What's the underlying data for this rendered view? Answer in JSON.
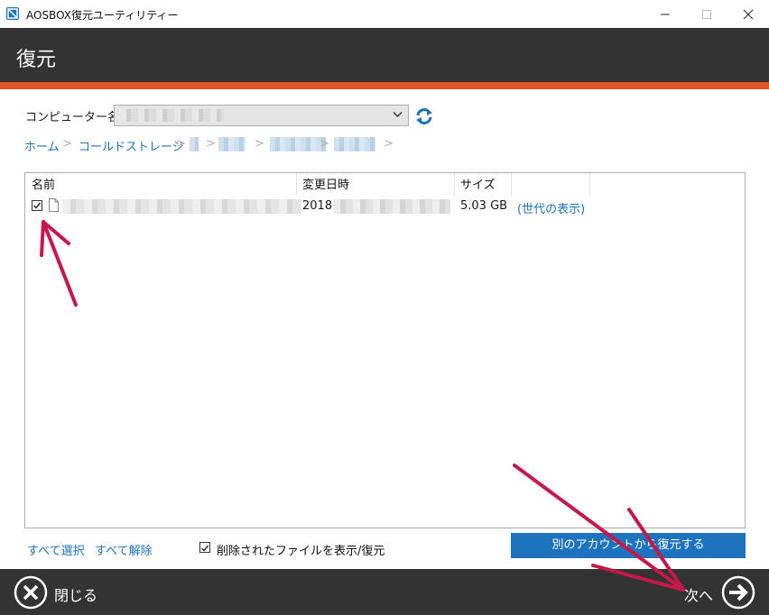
{
  "window": {
    "title": "AOSBOX復元ユーティリティー",
    "icon": "aosbox-app-icon",
    "controls": [
      "minimize-icon",
      "maximize-icon",
      "close-icon"
    ]
  },
  "header": {
    "title": "復元"
  },
  "computer": {
    "label": "コンピューター名:",
    "value": "",
    "refresh_icon": "refresh-icon"
  },
  "breadcrumb": {
    "items": [
      "ホーム",
      "コールドストレージ"
    ],
    "separator": ">"
  },
  "file_list": {
    "columns": [
      "名前",
      "変更日時",
      "サイズ"
    ],
    "rows": [
      {
        "checked": true,
        "name": "",
        "modified_prefix": "2018",
        "size": "5.03 GB",
        "generations_link": "(世代の表示)"
      }
    ]
  },
  "actions": {
    "select_all": "すべて選択",
    "deselect_all": "すべて解除",
    "show_deleted": {
      "checked": true,
      "label": "削除されたファイルを表示/復元"
    },
    "restore_other_account": "別のアカウントから復元する"
  },
  "footer": {
    "close_label": "閉じる",
    "next_label": "次へ"
  },
  "colors": {
    "header_bg": "#333333",
    "accent": "#e0542a",
    "link": "#1e73be",
    "button": "#1e73be",
    "annotation_arrow": "#c8174a"
  }
}
